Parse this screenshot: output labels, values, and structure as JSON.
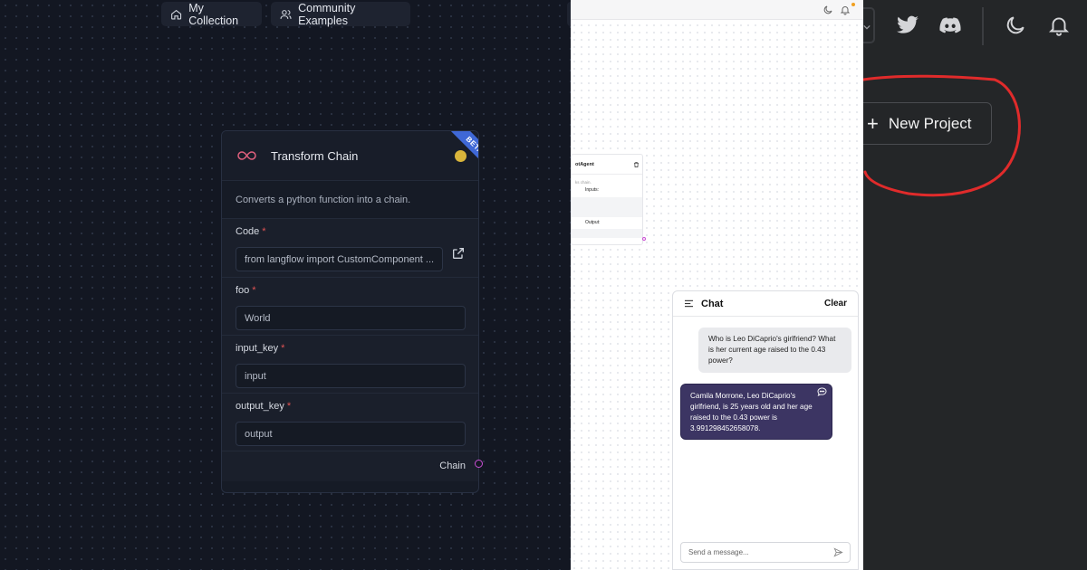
{
  "topbar": {
    "my_collection": "My Collection",
    "community_examples": "Community Examples"
  },
  "node": {
    "title": "Transform Chain",
    "badge": "BETA",
    "description": "Converts a python function into a chain.",
    "status_color": "#d9b53b",
    "fields": [
      {
        "label": "Code",
        "required": "*",
        "value": "from langflow import CustomComponent ..."
      },
      {
        "label": "foo",
        "required": "*",
        "value": "World"
      },
      {
        "label": "input_key",
        "required": "*",
        "value": "input"
      },
      {
        "label": "output_key",
        "required": "*",
        "value": "output"
      }
    ],
    "output_label": "Chain"
  },
  "mini_node": {
    "title": "otAgent",
    "subtitle": "ks chain.",
    "inputs_label": "Inputs:",
    "output_label": "Output:"
  },
  "chat": {
    "title": "Chat",
    "clear_label": "Clear",
    "messages": [
      {
        "role": "user",
        "text": "Who is Leo DiCaprio's girlfriend? What is her current age raised to the 0.43 power?"
      },
      {
        "role": "bot",
        "text": "Camila Morrone, Leo DiCaprio's girlfriend, is 25 years old and her age raised to the 0.43 power is 3.991298452658078."
      }
    ],
    "input_placeholder": "Send a message..."
  },
  "right": {
    "new_project_label": "New Project",
    "icons": [
      "twitter-icon",
      "discord-icon",
      "moon-icon",
      "bell-icon"
    ],
    "annotation_color": "#e02b2b"
  }
}
